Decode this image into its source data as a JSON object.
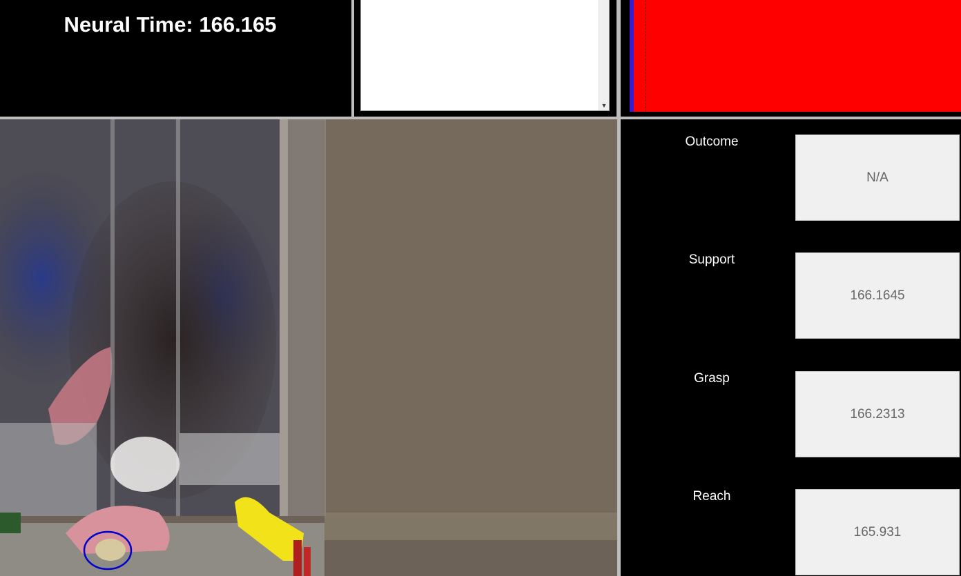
{
  "header": {
    "neural_time_label": "Neural Time:",
    "neural_time_value": "166.165"
  },
  "event_list": {
    "items": []
  },
  "raster": {
    "background_color": "#ff0000",
    "edge_color": "#3a1dd0"
  },
  "video": {
    "marker_color": "#0000cc",
    "marker_icon": "circle-annotation"
  },
  "events": [
    {
      "label": "Outcome",
      "value": "N/A"
    },
    {
      "label": "Support",
      "value": "166.1645"
    },
    {
      "label": "Grasp",
      "value": "166.2313"
    },
    {
      "label": "Reach",
      "value": "165.931"
    }
  ]
}
